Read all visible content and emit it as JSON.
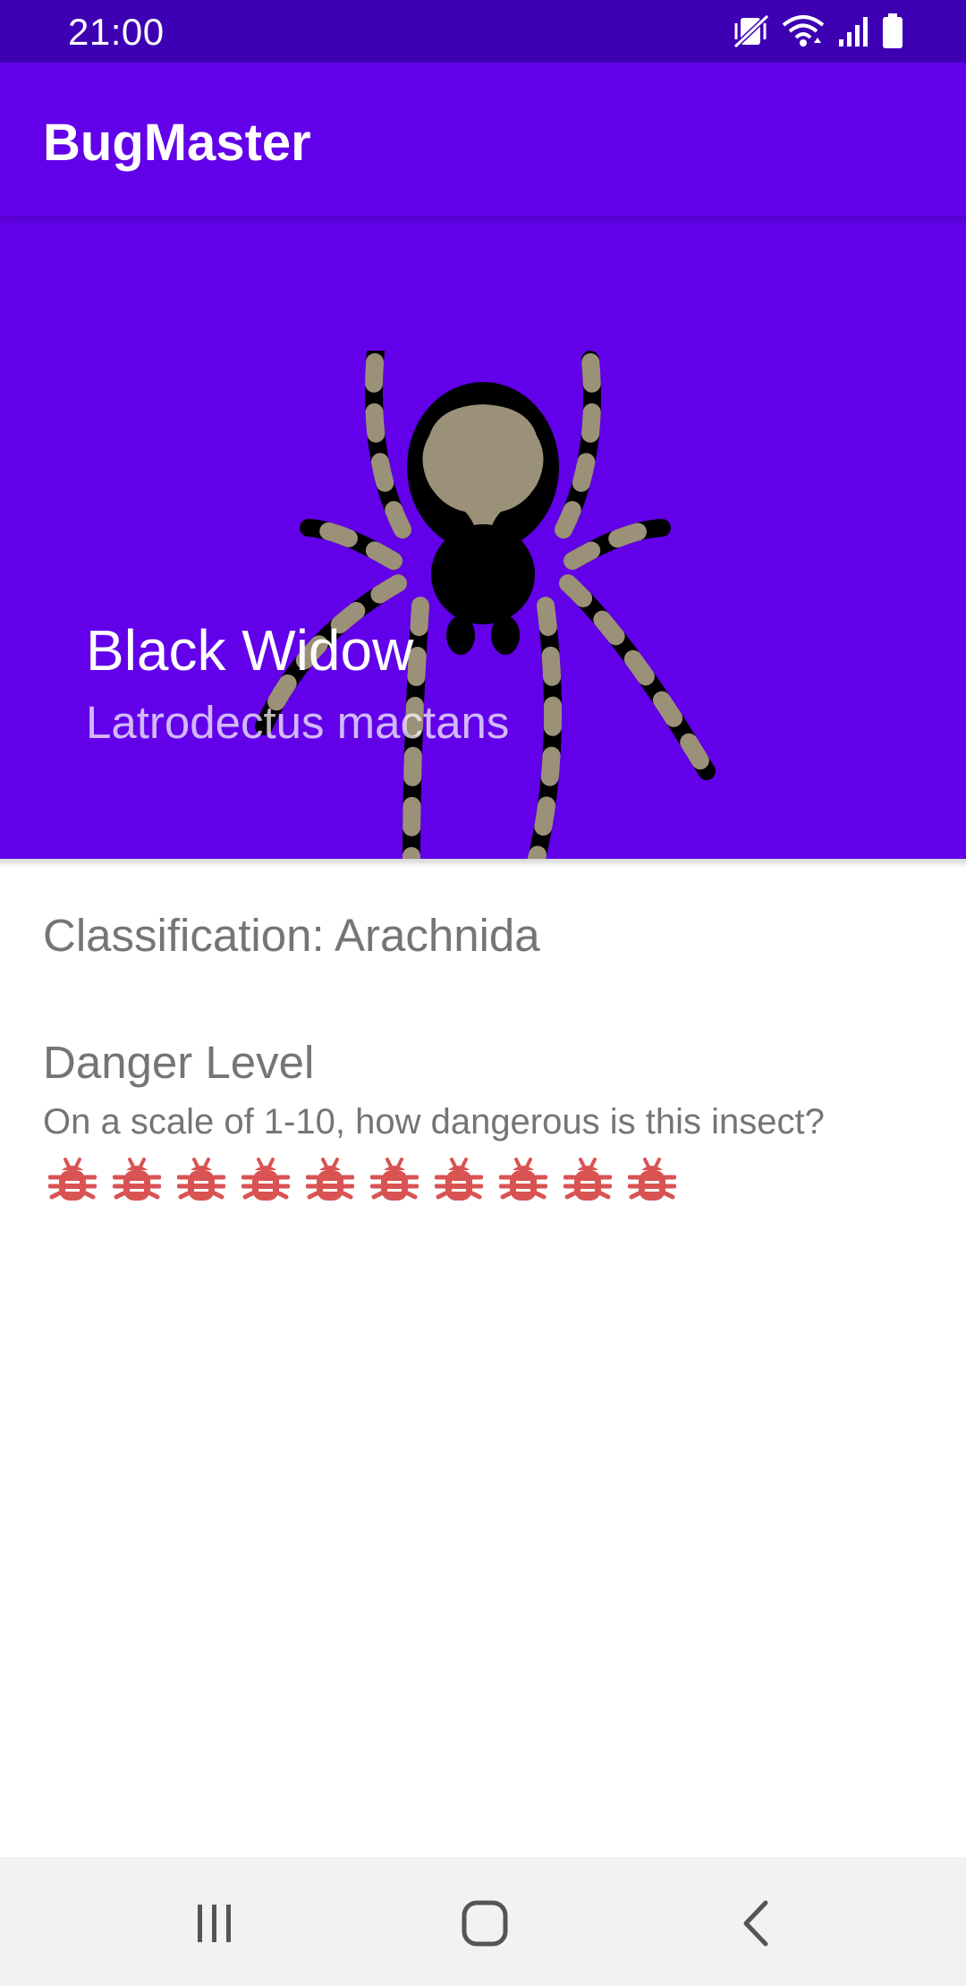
{
  "status_bar": {
    "time": "21:00",
    "icons": [
      "mute-vibrate-icon",
      "wifi-icon",
      "signal-icon",
      "battery-icon"
    ]
  },
  "app_bar": {
    "title": "BugMaster"
  },
  "hero": {
    "name": "Black Widow",
    "scientific_name": "Latrodectus mactans",
    "image": "spider-illustration",
    "background_color": "#6200ea"
  },
  "details": {
    "classification": "Classification: Arachnida",
    "danger_title": "Danger Level",
    "danger_question": "On a scale of 1-10, how dangerous is this insect?",
    "danger_level": 10,
    "danger_max": 10,
    "danger_icon": "bug-icon",
    "danger_icon_color": "#d95353"
  },
  "nav_bar": {
    "buttons": [
      "recent-apps-icon",
      "home-icon",
      "back-icon"
    ]
  },
  "colors": {
    "primary": "#6200ea",
    "primary_dark": "#3d00b3",
    "text_secondary": "#757575"
  }
}
